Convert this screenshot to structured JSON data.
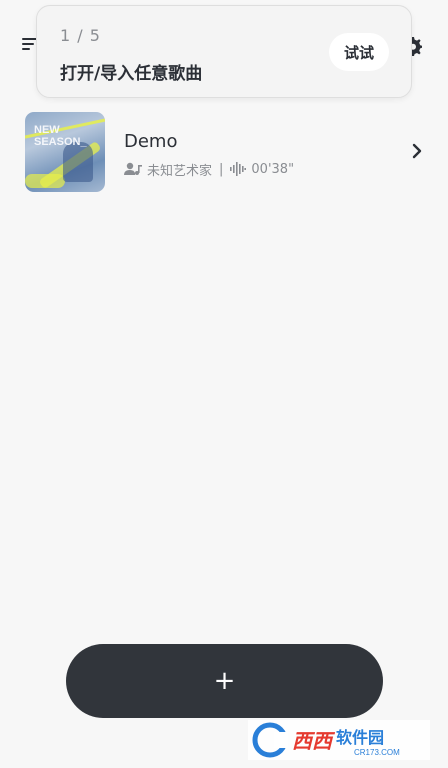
{
  "tip": {
    "step": "1 / 5",
    "text": "打开/导入任意歌曲",
    "button_label": "试试"
  },
  "song": {
    "title": "Demo",
    "artist": "未知艺术家",
    "separator": "|",
    "duration": "00'38\"",
    "cover_text": [
      "NEW",
      "SEASON_"
    ]
  },
  "add_button_label": "+",
  "watermark": {
    "brand": "西西软件园",
    "url": "CR173.COM"
  },
  "icons": [
    "menu-icon",
    "settings-icon",
    "artist-icon",
    "waveform-icon",
    "chevron-right-icon"
  ],
  "colors": {
    "background": "#f7f7f7",
    "primary_dark": "#31353b",
    "text": "#2b2f36",
    "muted": "#8a8d92",
    "cover_accent": "#e8f04a"
  }
}
